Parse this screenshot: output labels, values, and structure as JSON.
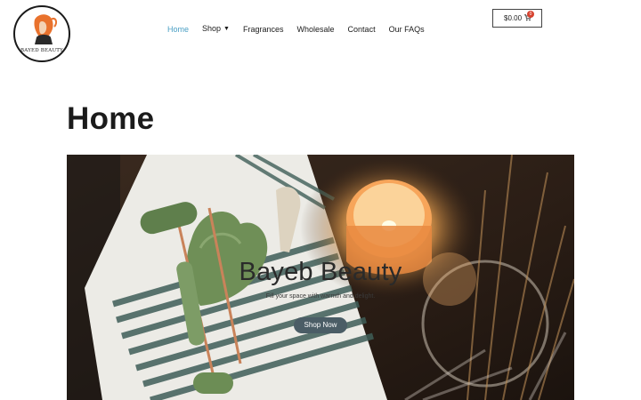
{
  "brand": {
    "logo_text": "BAYED BEAUTY"
  },
  "nav": {
    "items": [
      {
        "label": "Home",
        "active": true
      },
      {
        "label": "Shop",
        "dropdown": true
      },
      {
        "label": "Fragrances"
      },
      {
        "label": "Wholesale"
      },
      {
        "label": "Contact"
      },
      {
        "label": "Our FAQs"
      }
    ]
  },
  "cart": {
    "amount": "$0.00",
    "count": "0",
    "icon": "cart-icon"
  },
  "page": {
    "title": "Home"
  },
  "hero": {
    "title": "Bayeb Beauty",
    "subtitle": "Fill your space with warmth and delight.",
    "button_label": "Shop Now"
  },
  "colors": {
    "accent": "#4a9fc4",
    "badge": "#d6412e",
    "button": "#4b5d66"
  }
}
